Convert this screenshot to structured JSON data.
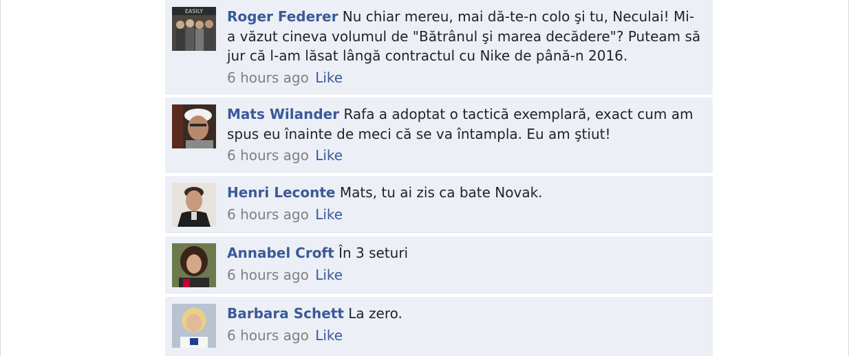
{
  "comments": [
    {
      "author": "Roger Federer",
      "text": "Nu chiar mereu, mai dă-te-n colo şi tu, Neculai! Mi-a văzut cineva volumul de \"Bătrânul şi marea decădere\"? Puteam să jur că l-am lăsat lângă contractul cu Nike de până-n 2016.",
      "time": "6 hours ago",
      "like_label": "Like",
      "avatar_caption": "EASILY"
    },
    {
      "author": "Mats Wilander",
      "text": "Rafa a adoptat o tactică exemplară, exact cum am spus eu înainte de meci că se va întampla. Eu am ştiut!",
      "time": "6 hours ago",
      "like_label": "Like"
    },
    {
      "author": "Henri Leconte",
      "text": "Mats, tu ai zis ca bate Novak.",
      "time": "6 hours ago",
      "like_label": "Like"
    },
    {
      "author": "Annabel Croft",
      "text": "În 3 seturi",
      "time": "6 hours ago",
      "like_label": "Like"
    },
    {
      "author": "Barbara Schett",
      "text": "La zero.",
      "time": "6 hours ago",
      "like_label": "Like"
    }
  ],
  "colors": {
    "author": "#3b5998",
    "comment_bg": "#eceff5",
    "meta": "#7f7f7f",
    "text": "#1d2129"
  }
}
